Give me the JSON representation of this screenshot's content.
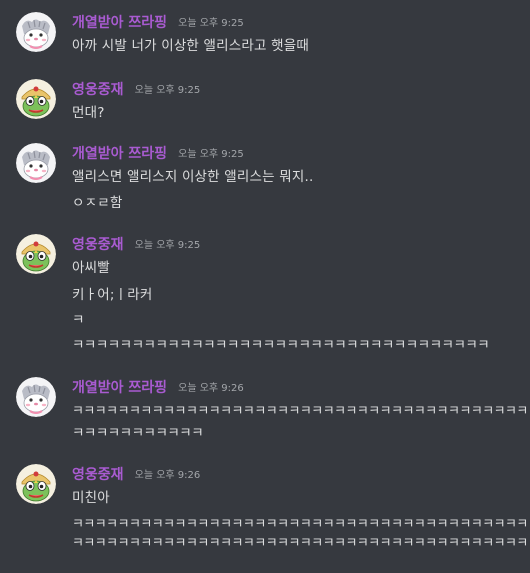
{
  "messages": [
    {
      "user": "개열받아 쯔라핑",
      "time": "오늘 오후 9:25",
      "avatar_icon": "hamster-avatar-icon",
      "lines": [
        "아까 시발 너가 이상한 앨리스라고 햇을때"
      ]
    },
    {
      "user": "영웅중재",
      "time": "오늘 오후 9:25",
      "avatar_icon": "frog-avatar-icon",
      "lines": [
        "먼대?"
      ]
    },
    {
      "user": "개열받아 쯔라핑",
      "time": "오늘 오후 9:25",
      "avatar_icon": "hamster-avatar-icon",
      "lines": [
        "앨리스면 앨리스지 이상한 앨리스는 뭐지..",
        "ㅇㅈㄹ함"
      ]
    },
    {
      "user": "영웅중재",
      "time": "오늘 오후 9:25",
      "avatar_icon": "frog-avatar-icon",
      "lines": [
        "아씨빨",
        "키ㅏ어;ㅣ라커",
        "ㅋ",
        "ㅋㅋㅋㅋㅋㅋㅋㅋㅋㅋㅋㅋㅋㅋㅋㅋㅋㅋㅋㅋㅋㅋㅋㅋㅋㅋㅋㅋㅋㅋㅋㅋㅋㅋㅋ"
      ]
    },
    {
      "user": "개열받아 쯔라핑",
      "time": "오늘 오후 9:26",
      "avatar_icon": "hamster-avatar-icon",
      "lines": [
        "ㅋㅋㅋㅋㅋㅋㅋㅋㅋㅋㅋㅋㅋㅋㅋㅋㅋㅋㅋㅋㅋㅋㅋㅋㅋㅋㅋㅋㅋㅋㅋㅋㅋㅋㅋㅋㅋㅋㅋㅋ",
        "ㅋㅋㅋㅋㅋㅋㅋㅋㅋㅋㅋ"
      ]
    },
    {
      "user": "영웅중재",
      "time": "오늘 오후 9:26",
      "avatar_icon": "frog-avatar-icon",
      "lines": [
        "미친아",
        "ㅋㅋㅋㅋㅋㅋㅋㅋㅋㅋㅋㅋㅋㅋㅋㅋㅋㅋㅋㅋㅋㅋㅋㅋㅋㅋㅋㅋㅋㅋㅋㅋㅋㅋㅋㅋㅋㅋㅋㅋ",
        "ㅋㅋㅋㅋㅋㅋㅋㅋㅋㅋㅋㅋㅋㅋㅋㅋㅋㅋㅋㅋㅋㅋㅋㅋㅋㅋㅋㅋㅋㅋㅋㅋㅋㅋㅋㅋㅋㅋㅋㅋ"
      ]
    }
  ]
}
